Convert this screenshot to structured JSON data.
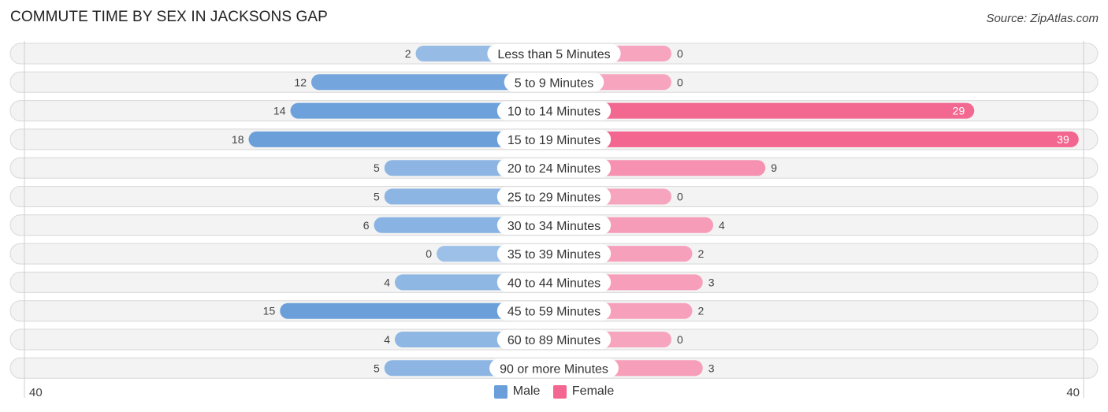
{
  "header": {
    "title": "COMMUTE TIME BY SEX IN JACKSONS GAP",
    "source": "Source: ZipAtlas.com"
  },
  "colors": {
    "male": "#6a9fda",
    "male_light": "#9dc0e8",
    "female": "#f2668f",
    "female_light": "#f7a4bf"
  },
  "chart_data": {
    "type": "bar",
    "orientation": "horizontal-diverging",
    "title": "COMMUTE TIME BY SEX IN JACKSONS GAP",
    "categories": [
      "Less than 5 Minutes",
      "5 to 9 Minutes",
      "10 to 14 Minutes",
      "15 to 19 Minutes",
      "20 to 24 Minutes",
      "25 to 29 Minutes",
      "30 to 34 Minutes",
      "35 to 39 Minutes",
      "40 to 44 Minutes",
      "45 to 59 Minutes",
      "60 to 89 Minutes",
      "90 or more Minutes"
    ],
    "series": [
      {
        "name": "Male",
        "values": [
          2,
          12,
          14,
          18,
          5,
          5,
          6,
          0,
          4,
          15,
          4,
          5
        ]
      },
      {
        "name": "Female",
        "values": [
          0,
          0,
          29,
          39,
          9,
          0,
          4,
          2,
          3,
          2,
          0,
          3
        ]
      }
    ],
    "xlim": [
      40,
      40
    ],
    "axis_labels": {
      "left": "40",
      "right": "40"
    },
    "legend": [
      "Male",
      "Female"
    ],
    "legend_position": "bottom-center",
    "grid": false
  }
}
